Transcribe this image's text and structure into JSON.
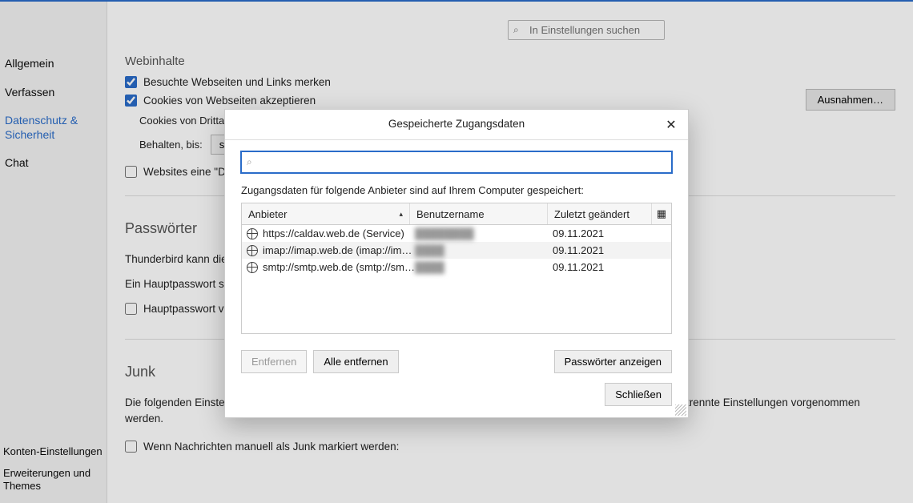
{
  "sidebar": {
    "items": [
      {
        "label": "Allgemein"
      },
      {
        "label": "Verfassen"
      },
      {
        "label": "Datenschutz & Sicherheit"
      },
      {
        "label": "Chat"
      }
    ],
    "bottom": [
      {
        "label": "Konten-Einstellungen"
      },
      {
        "label": "Erweiterungen und Themes"
      }
    ]
  },
  "search": {
    "placeholder": "In Einstellungen suchen"
  },
  "web": {
    "title": "Webinhalte",
    "visited": "Besuchte Webseiten und Links merken",
    "cookies": "Cookies von Webseiten akzeptieren",
    "exceptions": "Ausnahmen…",
    "third_party_label": "Cookies von Drittanbietern akzeptieren:",
    "third_party_partial": "Cookies von Drittan",
    "keep_label": "Behalten, bis:",
    "keep_value": "sie",
    "dnt_partial": "Websites eine \"Do "
  },
  "pw": {
    "title": "Passwörter",
    "line1": "Thunderbird kann die ",
    "line2": "Ein Hauptpasswort sch",
    "master_partial": "Hauptpasswort ver"
  },
  "junk": {
    "title": "Junk",
    "desc": "Die folgenden Einstellungen gelten für alle Konten. In den Konten-Einstellungen können zusätzlich für jedes Konto getrennte Einstellungen vorgenommen werden.",
    "manual": "Wenn Nachrichten manuell als Junk markiert werden:"
  },
  "dialog": {
    "title": "Gespeicherte Zugangsdaten",
    "desc": "Zugangsdaten für folgende Anbieter sind auf Ihrem Computer gespeichert:",
    "columns": {
      "provider": "Anbieter",
      "user": "Benutzername",
      "changed": "Zuletzt geändert"
    },
    "rows": [
      {
        "provider": "https://caldav.web.de (Service)",
        "user": "████████",
        "changed": "09.11.2021"
      },
      {
        "provider": "imap://imap.web.de (imap://imap.web…",
        "user": "████",
        "changed": "09.11.2021"
      },
      {
        "provider": "smtp://smtp.web.de (smtp://smtp.web…",
        "user": "████",
        "changed": "09.11.2021"
      }
    ],
    "remove": "Entfernen",
    "remove_all": "Alle entfernen",
    "show": "Passwörter anzeigen",
    "close": "Schließen"
  }
}
